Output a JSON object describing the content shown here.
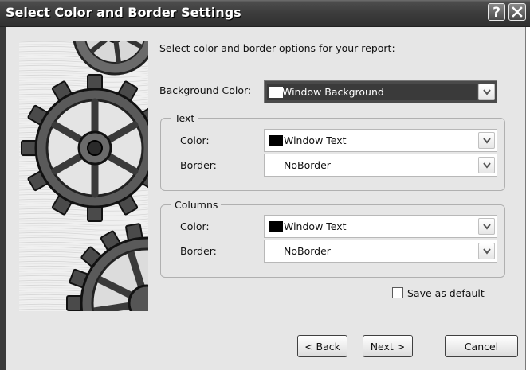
{
  "window": {
    "title": "Select Color and Border Settings",
    "help_glyph": "?",
    "close_icon": "close-icon"
  },
  "intro": "Select color and border options for your report:",
  "background": {
    "label": "Background Color:",
    "value": "Window Background",
    "swatch": "#ffffff"
  },
  "text_group": {
    "title": "Text",
    "color_label": "Color:",
    "color_value": "Window Text",
    "color_swatch": "#000000",
    "border_label": "Border:",
    "border_value": "NoBorder"
  },
  "columns_group": {
    "title": "Columns",
    "color_label": "Color:",
    "color_value": "Window Text",
    "color_swatch": "#000000",
    "border_label": "Border:",
    "border_value": "NoBorder"
  },
  "save_default": {
    "label": "Save as default",
    "checked": false
  },
  "buttons": {
    "back": "< Back",
    "next": "Next >",
    "cancel": "Cancel"
  },
  "colors": {
    "titlebar": "#3c3c3c",
    "dialog_bg": "#e6e6e6",
    "selection": "#3a3a3a"
  }
}
